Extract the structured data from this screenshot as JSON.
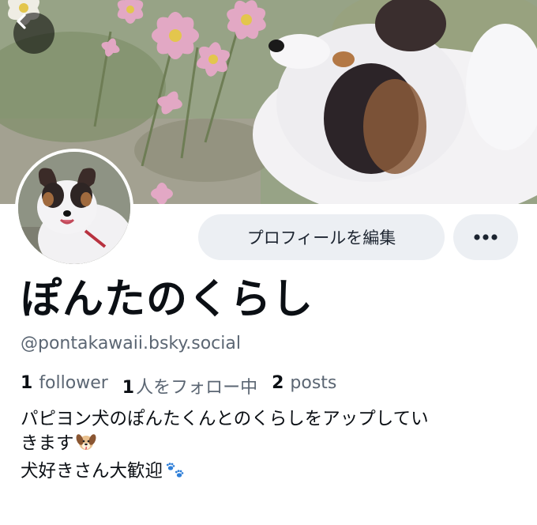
{
  "banner": {
    "icon": "cosmos-and-papillon-photo"
  },
  "nav": {
    "back_icon": "chevron-left-icon"
  },
  "avatar": {
    "icon": "papillon-dog-photo"
  },
  "actions": {
    "edit_profile_label": "プロフィールを編集",
    "more_icon": "ellipsis-icon"
  },
  "profile": {
    "display_name": "ぽんたのくらし",
    "handle": "@pontakawaii.bsky.social",
    "stats": {
      "followers_count": "1",
      "followers_label": "follower",
      "following_count": "1",
      "following_label": "人をフォロー中",
      "posts_count": "2",
      "posts_label": "posts"
    },
    "bio": {
      "line1": "パピヨン犬のぽんたくんとのくらしをアップしてい",
      "line2": "きます",
      "line2_emoji": "dog-face-emoji",
      "line3": "犬好きさん大歓迎",
      "line3_emoji": "paw-prints-emoji"
    }
  },
  "colors": {
    "accent_button_bg": "#eceff3",
    "muted_text": "#5b6673",
    "primary_text": "#0b0f14",
    "paw_blue": "#2f7fd8"
  }
}
